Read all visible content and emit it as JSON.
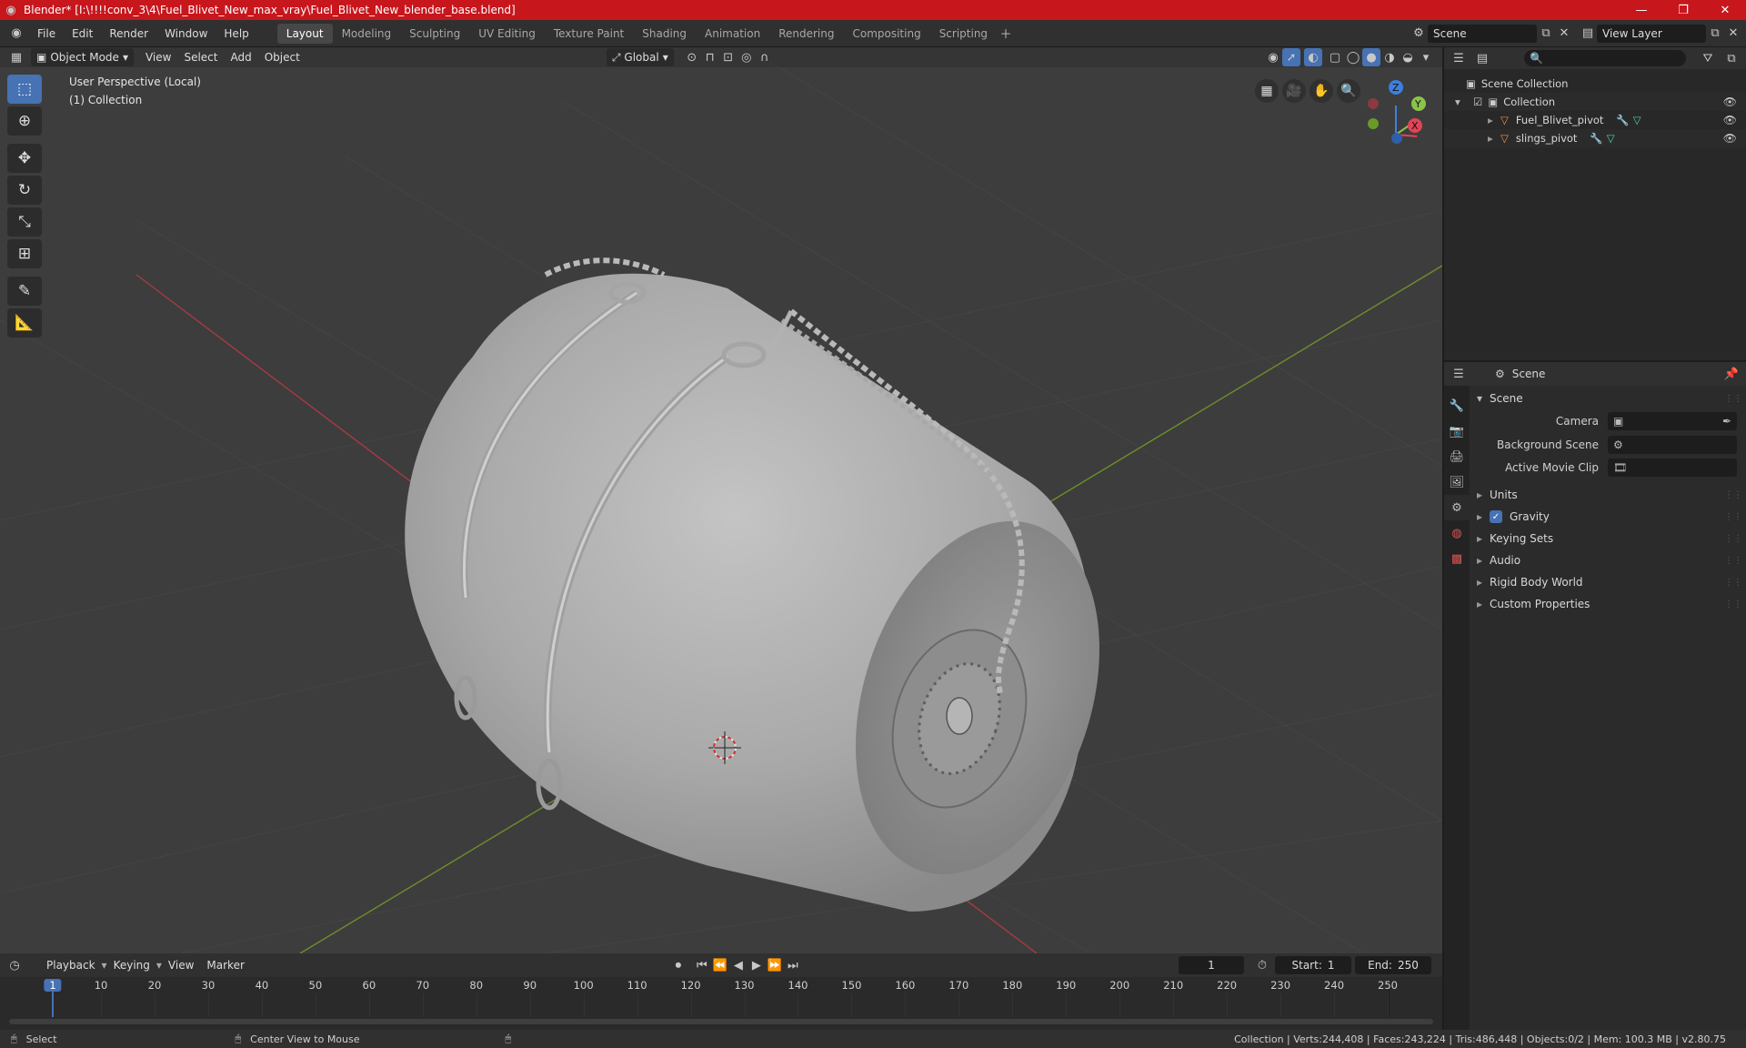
{
  "window": {
    "title": "Blender* [I:\\!!!!conv_3\\4\\Fuel_Blivet_New_max_vray\\Fuel_Blivet_New_blender_base.blend]"
  },
  "menu": [
    "File",
    "Edit",
    "Render",
    "Window",
    "Help"
  ],
  "workspaces": [
    "Layout",
    "Modeling",
    "Sculpting",
    "UV Editing",
    "Texture Paint",
    "Shading",
    "Animation",
    "Rendering",
    "Compositing",
    "Scripting"
  ],
  "scene_selector": {
    "value": "Scene"
  },
  "view_layer_selector": {
    "value": "View Layer"
  },
  "viewport": {
    "mode": "Object Mode",
    "menus": [
      "View",
      "Select",
      "Add",
      "Object"
    ],
    "orientation": "Global",
    "overlay_line1": "User Perspective (Local)",
    "overlay_line2": "(1) Collection"
  },
  "gizmo": {
    "x": "X",
    "y": "Y",
    "z": "Z"
  },
  "outliner": {
    "root": "Scene Collection",
    "collection": "Collection",
    "objects": [
      "Fuel_Blivet_pivot",
      "slings_pivot"
    ]
  },
  "properties": {
    "context": "Scene",
    "panel_title": "Scene",
    "camera_label": "Camera",
    "background_scene_label": "Background Scene",
    "active_movie_clip_label": "Active Movie Clip",
    "sections": [
      "Units",
      "Gravity",
      "Keying Sets",
      "Audio",
      "Rigid Body World",
      "Custom Properties"
    ]
  },
  "timeline": {
    "menus": [
      "Playback",
      "Keying",
      "View",
      "Marker"
    ],
    "current_frame": "1",
    "start_label": "Start:",
    "start": "1",
    "end_label": "End:",
    "end": "250",
    "ruler": [
      "1",
      "10",
      "20",
      "30",
      "40",
      "50",
      "60",
      "70",
      "80",
      "90",
      "100",
      "110",
      "120",
      "130",
      "140",
      "150",
      "160",
      "170",
      "180",
      "190",
      "200",
      "210",
      "220",
      "230",
      "240",
      "250"
    ]
  },
  "status": {
    "left_action": "Select",
    "middle_action": "Center View to Mouse",
    "stats": "Collection | Verts:244,408 | Faces:243,224 | Tris:486,448 | Objects:0/2 | Mem: 100.3 MB | v2.80.75"
  },
  "colors": {
    "title_bar": "#c8161d",
    "accent": "#4772b3",
    "axis_x": "#e24455",
    "axis_y": "#8bc34a",
    "axis_z": "#3d7fe0"
  }
}
